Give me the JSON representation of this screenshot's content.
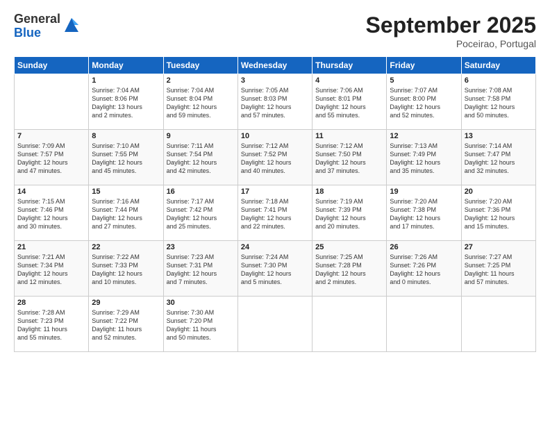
{
  "logo": {
    "general": "General",
    "blue": "Blue"
  },
  "header": {
    "month": "September 2025",
    "location": "Poceirao, Portugal"
  },
  "weekdays": [
    "Sunday",
    "Monday",
    "Tuesday",
    "Wednesday",
    "Thursday",
    "Friday",
    "Saturday"
  ],
  "weeks": [
    [
      {
        "day": "",
        "info": ""
      },
      {
        "day": "1",
        "info": "Sunrise: 7:04 AM\nSunset: 8:06 PM\nDaylight: 13 hours\nand 2 minutes."
      },
      {
        "day": "2",
        "info": "Sunrise: 7:04 AM\nSunset: 8:04 PM\nDaylight: 12 hours\nand 59 minutes."
      },
      {
        "day": "3",
        "info": "Sunrise: 7:05 AM\nSunset: 8:03 PM\nDaylight: 12 hours\nand 57 minutes."
      },
      {
        "day": "4",
        "info": "Sunrise: 7:06 AM\nSunset: 8:01 PM\nDaylight: 12 hours\nand 55 minutes."
      },
      {
        "day": "5",
        "info": "Sunrise: 7:07 AM\nSunset: 8:00 PM\nDaylight: 12 hours\nand 52 minutes."
      },
      {
        "day": "6",
        "info": "Sunrise: 7:08 AM\nSunset: 7:58 PM\nDaylight: 12 hours\nand 50 minutes."
      }
    ],
    [
      {
        "day": "7",
        "info": "Sunrise: 7:09 AM\nSunset: 7:57 PM\nDaylight: 12 hours\nand 47 minutes."
      },
      {
        "day": "8",
        "info": "Sunrise: 7:10 AM\nSunset: 7:55 PM\nDaylight: 12 hours\nand 45 minutes."
      },
      {
        "day": "9",
        "info": "Sunrise: 7:11 AM\nSunset: 7:54 PM\nDaylight: 12 hours\nand 42 minutes."
      },
      {
        "day": "10",
        "info": "Sunrise: 7:12 AM\nSunset: 7:52 PM\nDaylight: 12 hours\nand 40 minutes."
      },
      {
        "day": "11",
        "info": "Sunrise: 7:12 AM\nSunset: 7:50 PM\nDaylight: 12 hours\nand 37 minutes."
      },
      {
        "day": "12",
        "info": "Sunrise: 7:13 AM\nSunset: 7:49 PM\nDaylight: 12 hours\nand 35 minutes."
      },
      {
        "day": "13",
        "info": "Sunrise: 7:14 AM\nSunset: 7:47 PM\nDaylight: 12 hours\nand 32 minutes."
      }
    ],
    [
      {
        "day": "14",
        "info": "Sunrise: 7:15 AM\nSunset: 7:46 PM\nDaylight: 12 hours\nand 30 minutes."
      },
      {
        "day": "15",
        "info": "Sunrise: 7:16 AM\nSunset: 7:44 PM\nDaylight: 12 hours\nand 27 minutes."
      },
      {
        "day": "16",
        "info": "Sunrise: 7:17 AM\nSunset: 7:42 PM\nDaylight: 12 hours\nand 25 minutes."
      },
      {
        "day": "17",
        "info": "Sunrise: 7:18 AM\nSunset: 7:41 PM\nDaylight: 12 hours\nand 22 minutes."
      },
      {
        "day": "18",
        "info": "Sunrise: 7:19 AM\nSunset: 7:39 PM\nDaylight: 12 hours\nand 20 minutes."
      },
      {
        "day": "19",
        "info": "Sunrise: 7:20 AM\nSunset: 7:38 PM\nDaylight: 12 hours\nand 17 minutes."
      },
      {
        "day": "20",
        "info": "Sunrise: 7:20 AM\nSunset: 7:36 PM\nDaylight: 12 hours\nand 15 minutes."
      }
    ],
    [
      {
        "day": "21",
        "info": "Sunrise: 7:21 AM\nSunset: 7:34 PM\nDaylight: 12 hours\nand 12 minutes."
      },
      {
        "day": "22",
        "info": "Sunrise: 7:22 AM\nSunset: 7:33 PM\nDaylight: 12 hours\nand 10 minutes."
      },
      {
        "day": "23",
        "info": "Sunrise: 7:23 AM\nSunset: 7:31 PM\nDaylight: 12 hours\nand 7 minutes."
      },
      {
        "day": "24",
        "info": "Sunrise: 7:24 AM\nSunset: 7:30 PM\nDaylight: 12 hours\nand 5 minutes."
      },
      {
        "day": "25",
        "info": "Sunrise: 7:25 AM\nSunset: 7:28 PM\nDaylight: 12 hours\nand 2 minutes."
      },
      {
        "day": "26",
        "info": "Sunrise: 7:26 AM\nSunset: 7:26 PM\nDaylight: 12 hours\nand 0 minutes."
      },
      {
        "day": "27",
        "info": "Sunrise: 7:27 AM\nSunset: 7:25 PM\nDaylight: 11 hours\nand 57 minutes."
      }
    ],
    [
      {
        "day": "28",
        "info": "Sunrise: 7:28 AM\nSunset: 7:23 PM\nDaylight: 11 hours\nand 55 minutes."
      },
      {
        "day": "29",
        "info": "Sunrise: 7:29 AM\nSunset: 7:22 PM\nDaylight: 11 hours\nand 52 minutes."
      },
      {
        "day": "30",
        "info": "Sunrise: 7:30 AM\nSunset: 7:20 PM\nDaylight: 11 hours\nand 50 minutes."
      },
      {
        "day": "",
        "info": ""
      },
      {
        "day": "",
        "info": ""
      },
      {
        "day": "",
        "info": ""
      },
      {
        "day": "",
        "info": ""
      }
    ]
  ]
}
